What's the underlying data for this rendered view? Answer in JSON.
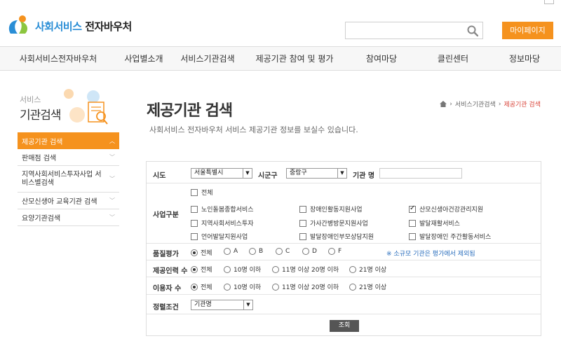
{
  "header": {
    "logo_primary": "사회서비스",
    "logo_secondary": "전자바우처",
    "search_placeholder": "",
    "mypage_label": "마이페이지"
  },
  "gnb": [
    {
      "label": "사회서비스전자바우처"
    },
    {
      "label": "사업별소개"
    },
    {
      "label": "서비스기관검색"
    },
    {
      "label": "제공기관 참여 및 평가"
    },
    {
      "label": "참여마당"
    },
    {
      "label": "클린센터"
    },
    {
      "label": "정보마당"
    }
  ],
  "sidebar": {
    "title_small": "서비스",
    "title_large": "기관검색",
    "items": [
      {
        "label": "제공기관 검색",
        "active": true
      },
      {
        "label": "판매점 검색"
      },
      {
        "label": "지역사회서비스투자사업 서비스별검색"
      },
      {
        "label": "산모신생아 교육기관 검색"
      },
      {
        "label": "요양기관검색"
      }
    ]
  },
  "page": {
    "title": "제공기관 검색",
    "desc": "사회서비스 전자바우처 서비스 제공기관 정보를 보실수 있습니다.",
    "breadcrumb": [
      "서비스기관검색",
      "제공기관 검색"
    ]
  },
  "form": {
    "row1": {
      "sido_label": "시도",
      "sido_value": "서울특별시",
      "sigungu_label": "시군구",
      "sigungu_value": "중랑구",
      "name_label": "기관 명",
      "name_value": ""
    },
    "business": {
      "label": "사업구분",
      "all_label": "전체",
      "options": [
        {
          "label": "노인돌봄종합서비스",
          "checked": false
        },
        {
          "label": "장애인활동지원사업",
          "checked": false
        },
        {
          "label": "산모신생아건강관리지원",
          "checked": true
        },
        {
          "label": "지역사회서비스투자",
          "checked": false
        },
        {
          "label": "가사간병방문지원사업",
          "checked": false
        },
        {
          "label": "발달재활서비스",
          "checked": false
        },
        {
          "label": "언어발달지원사업",
          "checked": false
        },
        {
          "label": "발달장애인부모상담지원",
          "checked": false
        },
        {
          "label": "발달장애인 주간활동서비스",
          "checked": false
        }
      ]
    },
    "rating": {
      "label": "품질평가",
      "options": [
        "전체",
        "A",
        "B",
        "C",
        "D",
        "F"
      ],
      "selected": "전체",
      "note": "※ 소규모 기관은 평가에서 제외됨"
    },
    "staff": {
      "label": "제공인력 수",
      "options": [
        "전체",
        "10명 이하",
        "11명 이상 20명 이하",
        "21명 이상"
      ],
      "selected": "전체"
    },
    "users": {
      "label": "이용자 수",
      "options": [
        "전체",
        "10명 이하",
        "11명 이상 20명 이하",
        "21명 이상"
      ],
      "selected": "전체"
    },
    "sort": {
      "label": "정렬조건",
      "value": "기관명"
    },
    "submit_label": "조회"
  },
  "colors": {
    "accent_orange": "#f5921e",
    "brand_blue": "#2a8ed6",
    "crumb_red": "#d9453a",
    "note_blue": "#2a6ebd"
  }
}
